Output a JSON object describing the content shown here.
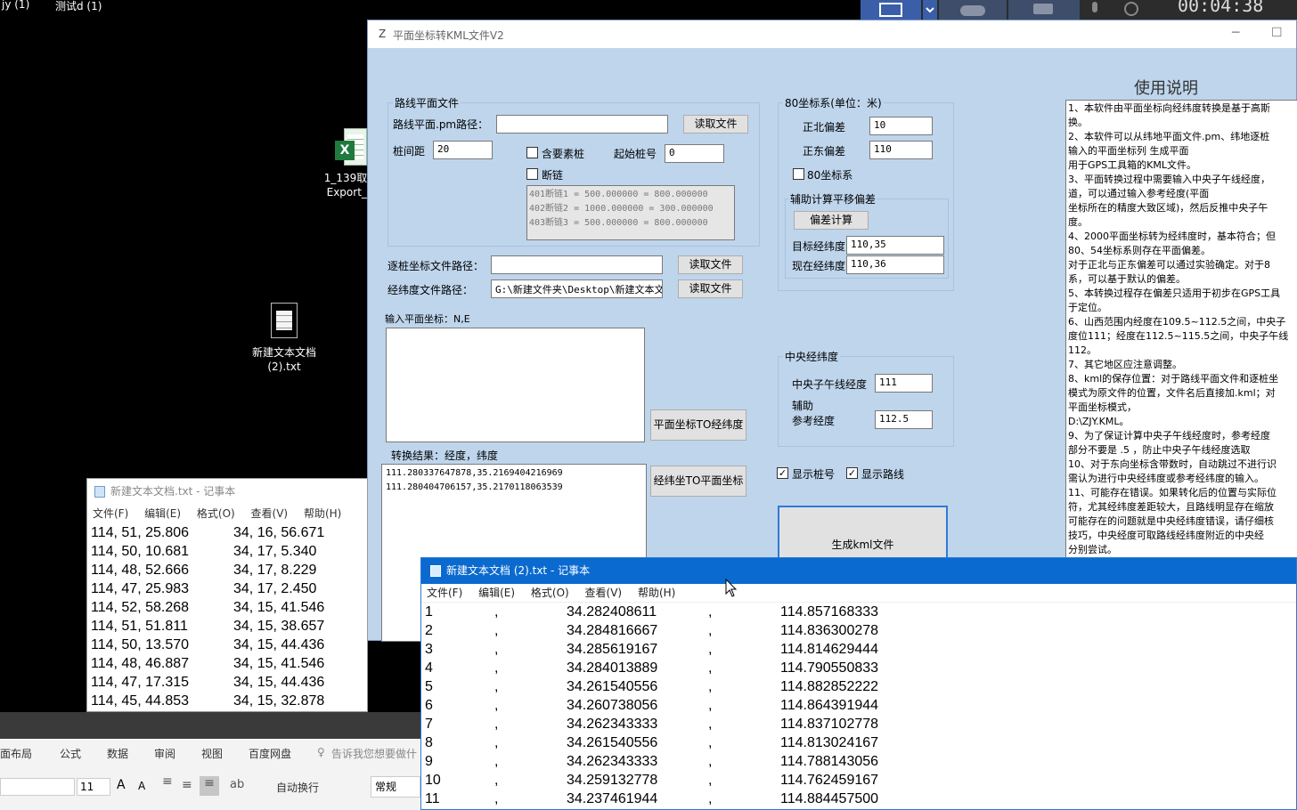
{
  "desktop": {
    "top_labels": [
      "jy (1)",
      "测试d (1)"
    ],
    "icons": [
      {
        "name": "1_139取样 Export_O",
        "line1": "1_139取样",
        "line2": "Export_O"
      },
      {
        "name": "新建文本文档 (2).txt",
        "line1": "新建文本文档",
        "line2": "(2).txt"
      }
    ]
  },
  "recorder": {
    "time": "00:04:38"
  },
  "app": {
    "icon_letter": "Z",
    "title": "平面坐标转KML文件V2",
    "route_group": {
      "title": "路线平面文件",
      "pm_path_label": "路线平面.pm路径：",
      "pm_path_value": "",
      "read_button": "读取文件",
      "interval_label": "桩间距",
      "interval_value": "20",
      "contains_stake_label": "含要素桩",
      "start_stake_label": "起始桩号",
      "start_stake_value": "0",
      "break_chain_label": "断链",
      "break_chain_lines": [
        "401断链1 = 500.000000 = 800.000000",
        "402断链2 = 1000.000000 = 300.000000",
        "403断链3 = 500.000000 = 800.000000"
      ]
    },
    "stake_path_label": "逐桩坐标文件路径：",
    "stake_path_value": "",
    "stake_read_button": "读取文件",
    "lonlat_path_label": "经纬度文件路径：",
    "lonlat_path_value": "G:\\新建文件夹\\Desktop\\新建文本文",
    "lonlat_read_button": "读取文件",
    "input_label": "输入平面坐标：N,E",
    "plane_to_lonlat_button": "平面坐标TO经纬度",
    "result_label": "转换结果：经度，纬度",
    "result_lines": [
      "111.280337647878,35.2169404216969",
      "111.280404706157,35.2170118063539"
    ],
    "lonlat_to_plane_button": "经纬坐TO平面坐标",
    "c80_group": {
      "title": "80坐标系(单位：米)",
      "north_label": "正北偏差",
      "north_value": "10",
      "east_label": "正东偏差",
      "east_value": "110",
      "c80_label": "80坐标系"
    },
    "aux_group": {
      "title": "辅助计算平移偏差",
      "calc_button": "偏差计算",
      "target_label": "目标经纬度",
      "target_value": "110,35",
      "current_label": "现在经纬度",
      "current_value": "110,36"
    },
    "central_group": {
      "title": "中央经纬度",
      "meridian_label": "中央子午线经度",
      "meridian_value": "111",
      "aux_label": "辅助",
      "ref_label": "参考经度",
      "ref_value": "112.5"
    },
    "show_stake_label": "显示桩号",
    "show_route_label": "显示路线",
    "generate_button": "生成kml文件",
    "instructions_title": "使用说明",
    "instructions": [
      "1、本软件由平面坐标向经纬度转换是基于高斯",
      "换。",
      "2、本软件可以从纬地平面文件.pm、纬地逐桩",
      "输入的平面坐标列 生成平面",
      "用于GPS工具箱的KML文件。",
      "3、平面转换过程中需要输入中央子午线经度，",
      "道，可以通过输入参考经度(平面",
      "坐标所在的精度大致区域)，然后反推中央子午",
      "度。",
      "4、2000平面坐标转为经纬度时，基本符合；但",
      "80、54坐标系则存在平面偏差。",
      "对于正北与正东偏差可以通过实验确定。对于8",
      "系，可以基于默认的偏差。",
      "5、本转换过程存在偏差只适用于初步在GPS工具",
      "于定位。",
      "6、山西范围内经度在109.5~112.5之间，中央子",
      "度位111；经度在112.5~115.5之间，中央子午线",
      "112。",
      "7、其它地区应注意调整。",
      "8、kml的保存位置：对于路线平面文件和逐桩坐",
      "模式为原文件的位置，文件名后直接加.kml；对",
      "平面坐标模式，",
      "D:\\ZJY.KML。",
      "9、为了保证计算中央子午线经度时，参考经度",
      "部分不要是  .5   ，防止中央子午线经度选取",
      "10、对于东向坐标含带数时，自动跳过不进行识",
      "需认为进行中央经纬度或参考经纬度的输入。",
      "11、可能存在错误。如果转化后的位置与实际位",
      "符，尤其经纬度差距较大，且路线明显存在缩放",
      "可能存在的问题就是中央经纬度错误，请仔细核",
      "技巧，中央经度可取路线经纬度附近的中央经",
      "分别尝试。"
    ]
  },
  "notepad_small": {
    "title": "新建文本文档.txt - 记事本",
    "menu": [
      "文件(F)",
      "编辑(E)",
      "格式(O)",
      "查看(V)",
      "帮助(H)"
    ],
    "rows": [
      [
        "114, 51, 25.806",
        "34, 16, 56.671"
      ],
      [
        "114, 50, 10.681",
        "34, 17, 5.340"
      ],
      [
        "114, 48, 52.666",
        "34, 17, 8.229"
      ],
      [
        "114, 47, 25.983",
        "34, 17, 2.450"
      ],
      [
        "114, 52, 58.268",
        "34, 15, 41.546"
      ],
      [
        "114, 51, 51.811",
        "34, 15, 38.657"
      ],
      [
        "114, 50, 13.570",
        "34, 15, 44.436"
      ],
      [
        "114, 48, 46.887",
        "34, 15, 41.546"
      ],
      [
        "114, 47, 17.315",
        "34, 15, 44.436"
      ],
      [
        "114, 45, 44.853",
        "34, 15, 32.878"
      ]
    ]
  },
  "excel": {
    "tabs": [
      "面布局",
      "公式",
      "数据",
      "审阅",
      "视图",
      "百度网盘",
      "告诉我您想要做什"
    ],
    "font_size": "11",
    "wrap_label": "自动换行",
    "format_label": "常规"
  },
  "notepad_big": {
    "title": "新建文本文档 (2).txt - 记事本",
    "menu": [
      "文件(F)",
      "编辑(E)",
      "格式(O)",
      "查看(V)",
      "帮助(H)"
    ],
    "rows": [
      [
        "1",
        ",",
        "34.282408611",
        ",",
        "114.857168333"
      ],
      [
        "2",
        ",",
        "34.284816667",
        ",",
        "114.836300278"
      ],
      [
        "3",
        ",",
        "34.285619167",
        ",",
        "114.814629444"
      ],
      [
        "4",
        ",",
        "34.284013889",
        ",",
        "114.790550833"
      ],
      [
        "5",
        ",",
        "34.261540556",
        ",",
        "114.882852222"
      ],
      [
        "6",
        ",",
        "34.260738056",
        ",",
        "114.864391944"
      ],
      [
        "7",
        ",",
        "34.262343333",
        ",",
        "114.837102778"
      ],
      [
        "8",
        ",",
        "34.261540556",
        ",",
        "114.813024167"
      ],
      [
        "9",
        ",",
        "34.262343333",
        ",",
        "114.788143056"
      ],
      [
        "10",
        ",",
        "34.259132778",
        ",",
        "114.762459167"
      ],
      [
        "11",
        ",",
        "34.237461944",
        ",",
        "114.884457500"
      ]
    ]
  }
}
